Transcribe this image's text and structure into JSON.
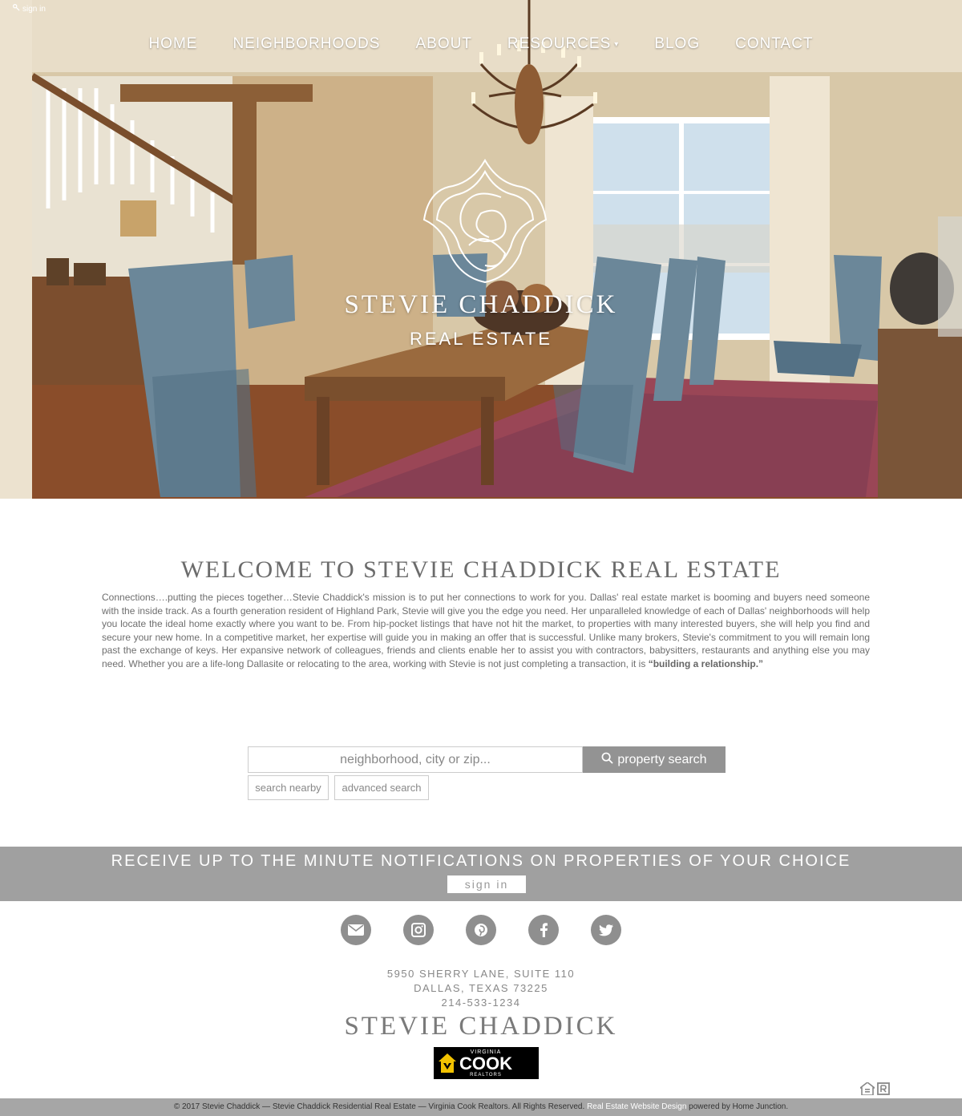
{
  "topbar": {
    "signin_label": "sign in"
  },
  "nav": {
    "home": "HOME",
    "neighborhoods": "NEIGHBORHOODS",
    "about": "ABOUT",
    "resources": "RESOURCES",
    "blog": "BLOG",
    "contact": "CONTACT"
  },
  "hero": {
    "brand_name": "STEVIE CHADDICK",
    "brand_sub": "REAL ESTATE"
  },
  "welcome": {
    "title": "WELCOME TO STEVIE CHADDICK REAL ESTATE",
    "body": "Connections….putting the pieces together…Stevie Chaddick's mission is to put her connections to work for you. Dallas' real estate market is booming and buyers need someone with the inside track. As a fourth generation resident of Highland Park, Stevie will give you the edge you need. Her unparalleled knowledge of each of Dallas' neighborhoods will help you locate the ideal home exactly where you want to be. From hip-pocket listings that have not hit the market, to properties with many interested buyers, she will help you find and secure your new home. In a competitive market, her expertise will guide you in making an offer that is successful. Unlike many brokers, Stevie's commitment to you will remain long past the exchange of keys. Her expansive network of colleagues, friends and clients enable her to assist you with contractors, babysitters, restaurants and anything else you may need. Whether you are a life-long Dallasite or relocating to the area, working with Stevie is not just completing a transaction, it is ",
    "emphasis": "“building a relationship.”"
  },
  "search": {
    "placeholder": "neighborhood, city or zip...",
    "button_label": "property search",
    "nearby_label": "search nearby",
    "advanced_label": "advanced search"
  },
  "notify": {
    "text": "RECEIVE UP TO THE MINUTE NOTIFICATIONS ON PROPERTIES OF YOUR CHOICE",
    "button_label": "sign in"
  },
  "social": [
    "envelope-icon",
    "instagram-icon",
    "pinterest-icon",
    "facebook-icon",
    "twitter-icon"
  ],
  "footer": {
    "address_line1": "5950 SHERRY LANE, SUITE 110",
    "address_line2": "DALLAS, TEXAS 73225",
    "phone": "214-533-1234",
    "name": "STEVIE CHADDICK",
    "logo": {
      "top": "VIRGINIA",
      "main": "COOK",
      "bottom": "REALTORS"
    }
  },
  "copyright": {
    "text": "© 2017 Stevie Chaddick — Stevie Chaddick Residential Real Estate — Virginia Cook Realtors. All Rights Reserved.",
    "link": "Real Estate Website Design",
    "suffix": "powered by Home Junction."
  },
  "colors": {
    "nav_text": "#ffffff",
    "bar_gray": "#a0a0a0",
    "button_gray": "#939393",
    "footer_bar": "#a6a6a6"
  }
}
